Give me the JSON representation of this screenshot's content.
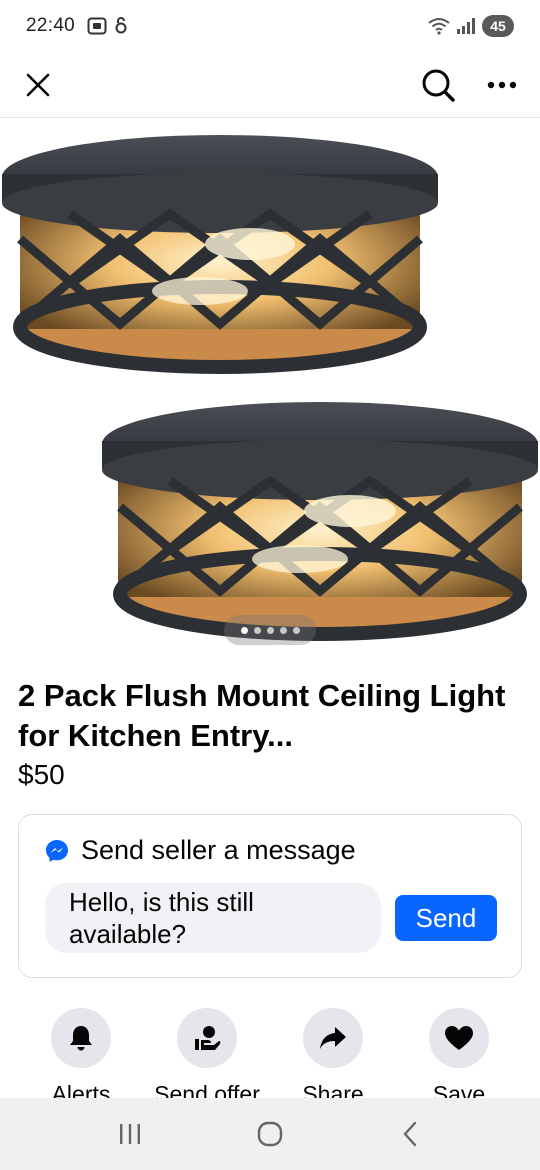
{
  "status_bar": {
    "time": "22:40",
    "battery": "45",
    "icons": [
      "screenshot-icon",
      "lock-icon",
      "wifi-icon",
      "signal-icon"
    ]
  },
  "nav": {
    "close_icon": "close-icon",
    "search_icon": "search-icon",
    "more_icon": "more-icon"
  },
  "photo": {
    "image_count": 5,
    "active_index": 0
  },
  "listing": {
    "title": "2 Pack Flush Mount Ceiling Light for Kitchen Entry...",
    "price": "$50"
  },
  "message": {
    "heading": "Send seller a message",
    "input_value": "Hello, is this still available?",
    "send_label": "Send"
  },
  "actions": [
    {
      "label": "Alerts",
      "icon": "bell-icon"
    },
    {
      "label": "Send offer",
      "icon": "offer-icon"
    },
    {
      "label": "Share",
      "icon": "share-icon"
    },
    {
      "label": "Save",
      "icon": "heart-icon"
    }
  ],
  "colors": {
    "accent": "#0866ff",
    "action_bg": "#e4e6eb",
    "input_bg": "#f0f2f5",
    "lamp_body": "#3a3d42",
    "lamp_glow": "#f2c070"
  }
}
